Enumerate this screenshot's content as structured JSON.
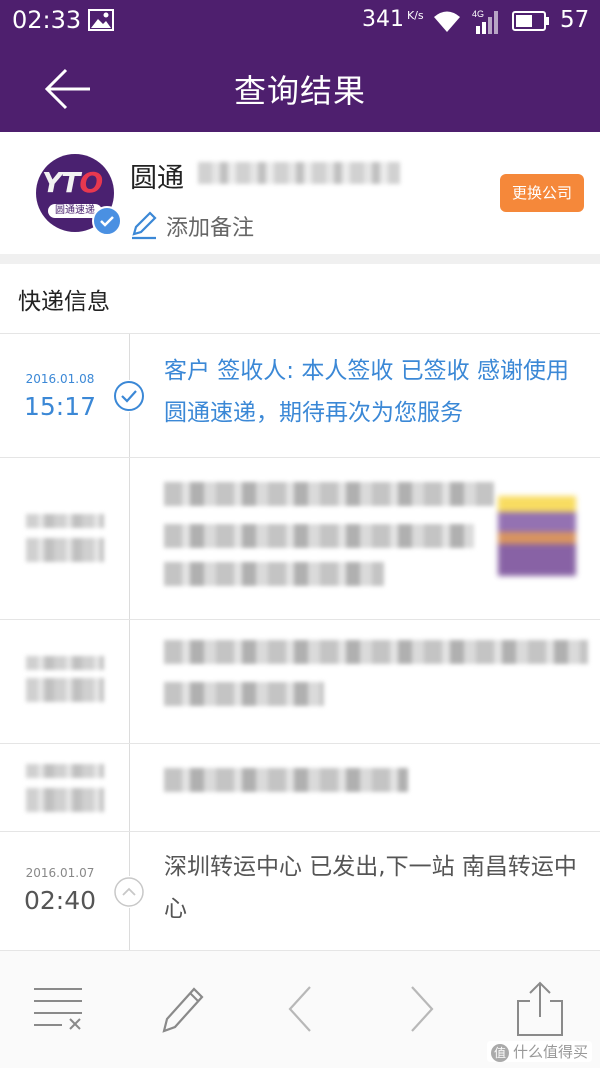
{
  "status_bar": {
    "time": "02:33",
    "net_speed": "341",
    "net_speed_unit": "K/s",
    "network_type": "4G",
    "battery": "57",
    "icons": [
      "image-icon",
      "wifi-icon",
      "signal-icon",
      "battery-icon"
    ]
  },
  "header": {
    "title": "查询结果",
    "back_icon": "arrow-left-icon",
    "bg_color": "#4e1f6e"
  },
  "company": {
    "name": "圆通",
    "tracking_number": "",
    "logo_text": "YTO",
    "logo_sub": "圆通速递",
    "note_label": "添加备注",
    "change_button": "更换公司",
    "accent_color": "#f5883a"
  },
  "section": {
    "title": "快递信息"
  },
  "events": [
    {
      "date": "2016.01.08",
      "time": "15:17",
      "text": "客户 签收人: 本人签收 已签收 感谢使用圆通速递，期待再次为您服务",
      "status": "delivered",
      "color": "#3b88d6"
    },
    {
      "date": "",
      "time": "",
      "text": "",
      "status": "obscured"
    },
    {
      "date": "",
      "time": "",
      "text": "",
      "status": "obscured"
    },
    {
      "date": "",
      "time": "",
      "text": "",
      "status": "obscured"
    },
    {
      "date": "2016.01.07",
      "time": "02:40",
      "text": "深圳转运中心 已发出,下一站 南昌转运中心",
      "status": "in-transit"
    }
  ],
  "toolbar": {
    "icons": [
      "clear-list-icon",
      "edit-icon",
      "previous-icon",
      "next-icon",
      "share-icon"
    ]
  },
  "watermark": "什么值得买"
}
